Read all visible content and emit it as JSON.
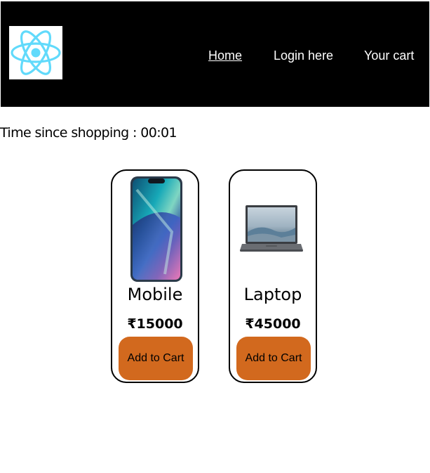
{
  "nav": {
    "logo_icon": "react-logo-icon",
    "links": [
      "Home",
      "Login here",
      "Your cart"
    ]
  },
  "timer": {
    "label": "Time since shopping : 00:01"
  },
  "products": [
    {
      "name": "Mobile",
      "price": "₹15000",
      "button_label": "Add to Cart",
      "image_icon": "smartphone-image"
    },
    {
      "name": "Laptop",
      "price": "₹45000",
      "button_label": "Add to Cart",
      "image_icon": "laptop-image"
    }
  ],
  "colors": {
    "navbar_bg": "#000000",
    "nav_text": "#ffffff",
    "button_bg": "#d2691e",
    "react_blue": "#61dafb"
  }
}
